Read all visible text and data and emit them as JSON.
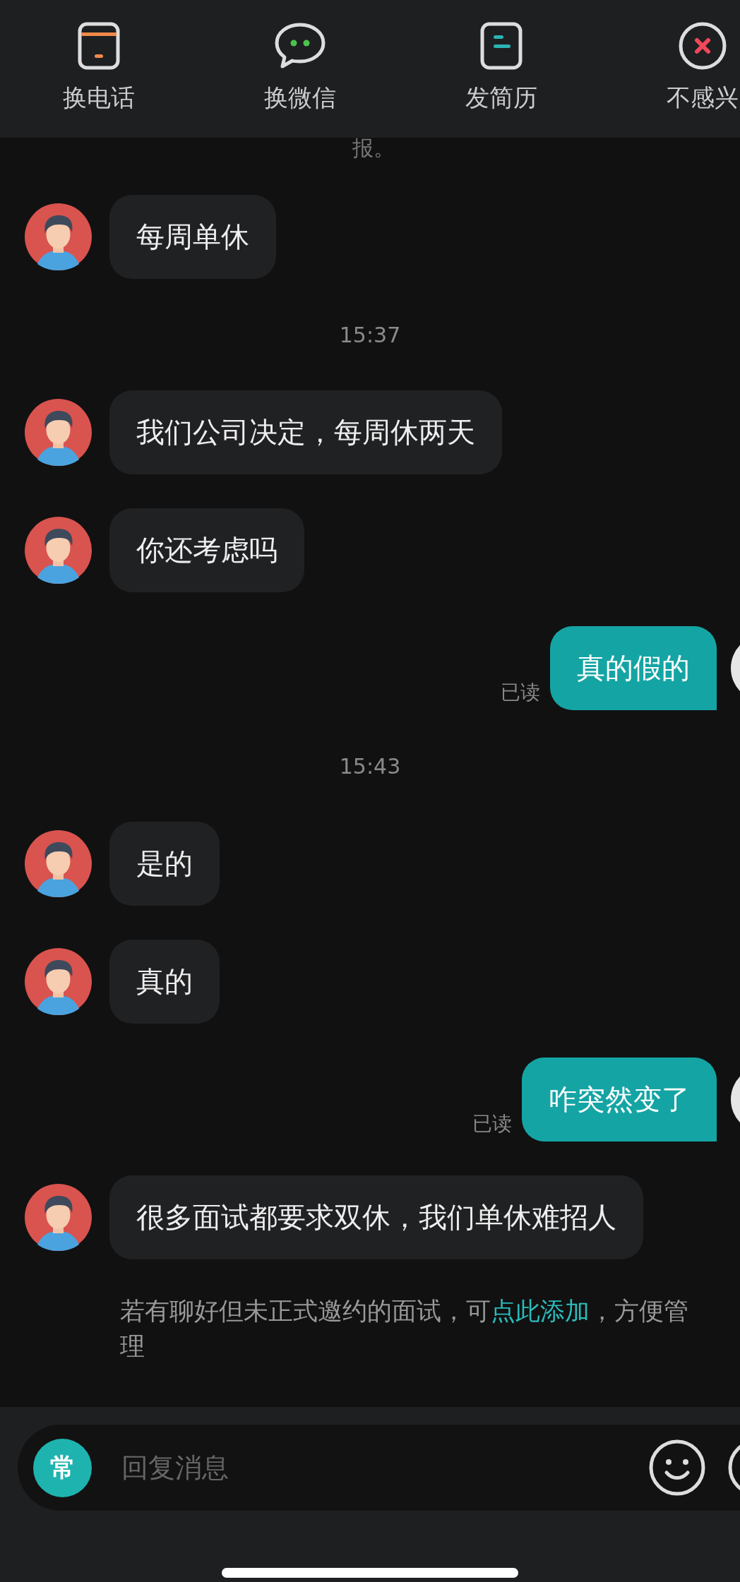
{
  "toolbar": [
    {
      "kind": "phone",
      "label": "换电话"
    },
    {
      "kind": "wechat",
      "label": "换微信"
    },
    {
      "kind": "resume",
      "label": "发简历"
    },
    {
      "kind": "dismiss",
      "label": "不感兴"
    }
  ],
  "messages": [
    {
      "kind": "partial",
      "text": "报。"
    },
    {
      "kind": "received",
      "text": "每周单休"
    },
    {
      "kind": "time",
      "text": "15:37"
    },
    {
      "kind": "received",
      "text": "我们公司决定，每周休两天"
    },
    {
      "kind": "received",
      "text": "你还考虑吗"
    },
    {
      "kind": "sent",
      "text": "真的假的",
      "status": "已读"
    },
    {
      "kind": "time",
      "text": "15:43"
    },
    {
      "kind": "received",
      "text": "是的"
    },
    {
      "kind": "received",
      "text": "真的"
    },
    {
      "kind": "sent",
      "text": "咋突然变了",
      "status": "已读"
    },
    {
      "kind": "received",
      "text": "很多面试都要求双休，我们单休难招人"
    }
  ],
  "notice": {
    "text": "若有聊好但未正式邀约的面试，可",
    "link": "点此添加",
    "after": "，方便管理"
  },
  "composer": {
    "quick_label": "常",
    "placeholder": "回复消息"
  }
}
